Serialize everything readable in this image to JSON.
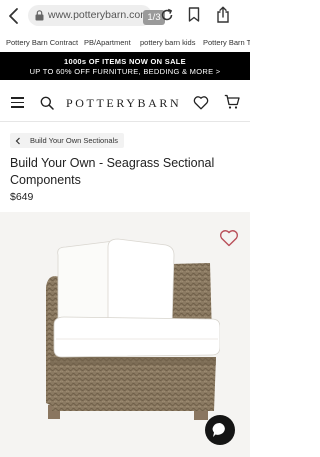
{
  "browser": {
    "url": "www.potterybarn.com",
    "tab_counter": "1/3"
  },
  "bookmarks": [
    "Pottery Barn Contract",
    "PB/Apartment",
    "pottery barn kids",
    "Pottery Barn Te"
  ],
  "promo": {
    "line1": "1000s OF ITEMS NOW ON SALE",
    "line2": "UP TO 60% OFF FURNITURE, BEDDING & MORE >"
  },
  "header": {
    "logo": "POTTERYBARN"
  },
  "breadcrumb": {
    "label": "Build Your Own Sectionals"
  },
  "product": {
    "title": "Build Your Own - Seagrass Sectional Components",
    "price": "$649"
  },
  "colors": {
    "promo_bg": "#000000",
    "text": "#222222",
    "breadcrumb_bg": "#f2f2f2",
    "wishlist_heart": "#b9505a",
    "chat_button": "#151515"
  },
  "icons": [
    "back-icon",
    "lock-icon",
    "reload-icon",
    "bookmark-icon",
    "share-icon",
    "menu-icon",
    "search-icon",
    "heart-icon",
    "cart-icon",
    "chevron-left-icon",
    "wishlist-heart-icon",
    "chat-icon"
  ]
}
